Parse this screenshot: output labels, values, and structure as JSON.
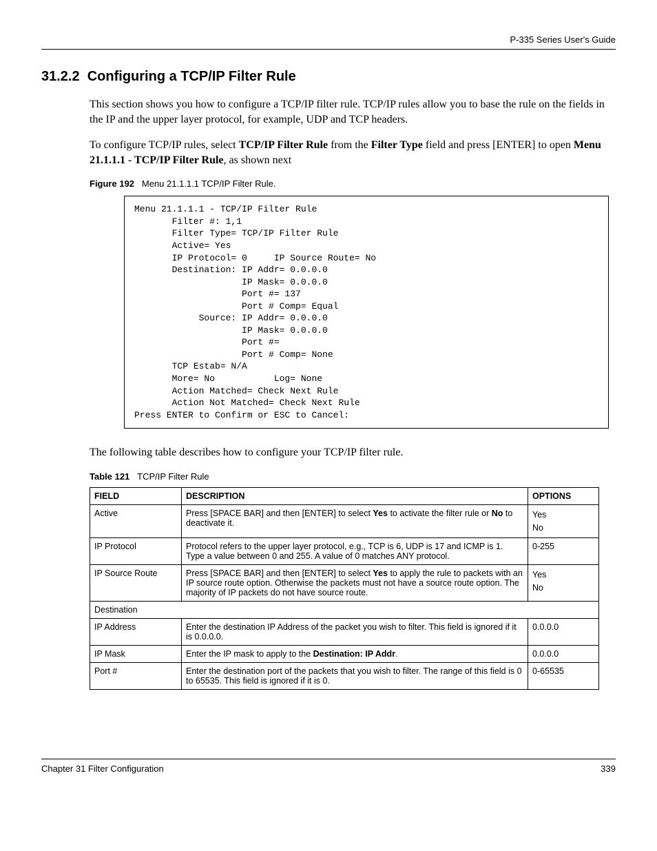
{
  "header": {
    "guide": "P-335 Series User's Guide"
  },
  "section": {
    "number": "31.2.2",
    "title": "Configuring a TCP/IP Filter Rule"
  },
  "paragraphs": {
    "p1": "This section shows you how to configure a TCP/IP filter rule. TCP/IP rules allow you to base the rule on the fields in the IP and the upper layer protocol, for example, UDP and TCP headers.",
    "p2_prefix": "To configure TCP/IP rules, select ",
    "p2_b1": "TCP/IP Filter Rule",
    "p2_mid1": " from the ",
    "p2_b2": "Filter Type",
    "p2_mid2": " field and press [ENTER] to open ",
    "p2_b3": "Menu 21.1.1.1 - TCP/IP Filter Rule",
    "p2_suffix": ", as shown next",
    "p3": "The following table describes how to configure your TCP/IP filter rule."
  },
  "figure": {
    "label": "Figure 192",
    "title": "Menu 21.1.1.1 TCP/IP Filter Rule.",
    "menu_text": "Menu 21.1.1.1 - TCP/IP Filter Rule\n       Filter #: 1,1\n       Filter Type= TCP/IP Filter Rule\n       Active= Yes\n       IP Protocol= 0     IP Source Route= No\n       Destination: IP Addr= 0.0.0.0\n                    IP Mask= 0.0.0.0\n                    Port #= 137\n                    Port # Comp= Equal\n            Source: IP Addr= 0.0.0.0\n                    IP Mask= 0.0.0.0\n                    Port #=\n                    Port # Comp= None\n       TCP Estab= N/A\n       More= No           Log= None\n       Action Matched= Check Next Rule\n       Action Not Matched= Check Next Rule\nPress ENTER to Confirm or ESC to Cancel:"
  },
  "table": {
    "label": "Table 121",
    "title": "TCP/IP Filter Rule",
    "headers": {
      "field": "FIELD",
      "desc": "DESCRIPTION",
      "opts": "OPTIONS"
    },
    "rows": {
      "r1": {
        "field": "Active",
        "desc_pre": "Press [SPACE BAR] and then [ENTER] to select ",
        "desc_b1": "Yes",
        "desc_mid": " to activate the filter rule or ",
        "desc_b2": "No",
        "desc_post": " to deactivate it.",
        "opts_l1": "Yes",
        "opts_l2": "No"
      },
      "r2": {
        "field": "IP Protocol",
        "desc": "Protocol refers to the upper layer protocol, e.g., TCP is 6, UDP is 17 and ICMP is 1. Type a value between 0 and 255. A value of 0 matches ANY protocol.",
        "opts": "0-255"
      },
      "r3": {
        "field": "IP Source Route",
        "desc_pre": "Press [SPACE BAR] and then [ENTER] to select ",
        "desc_b1": "Yes",
        "desc_post": " to apply the rule to packets with an IP source route option. Otherwise the packets must not have a source route option. The majority of IP packets do not have source route.",
        "opts_l1": "Yes",
        "opts_l2": "No"
      },
      "section1": {
        "field": "Destination"
      },
      "r4": {
        "field": "IP Address",
        "desc": "Enter the destination IP Address of the packet you wish to filter. This field is ignored if it is 0.0.0.0.",
        "opts": "0.0.0.0"
      },
      "r5": {
        "field": "IP Mask",
        "desc_pre": "Enter the IP mask to apply to the ",
        "desc_b1": "Destination: IP Addr",
        "desc_post": ".",
        "opts": "0.0.0.0"
      },
      "r6": {
        "field": "Port #",
        "desc": "Enter the destination port of the packets that you wish to filter. The range of this field is 0 to 65535. This field is ignored if it is 0.",
        "opts": "0-65535"
      }
    }
  },
  "footer": {
    "left": "Chapter 31 Filter Configuration",
    "right": "339"
  }
}
